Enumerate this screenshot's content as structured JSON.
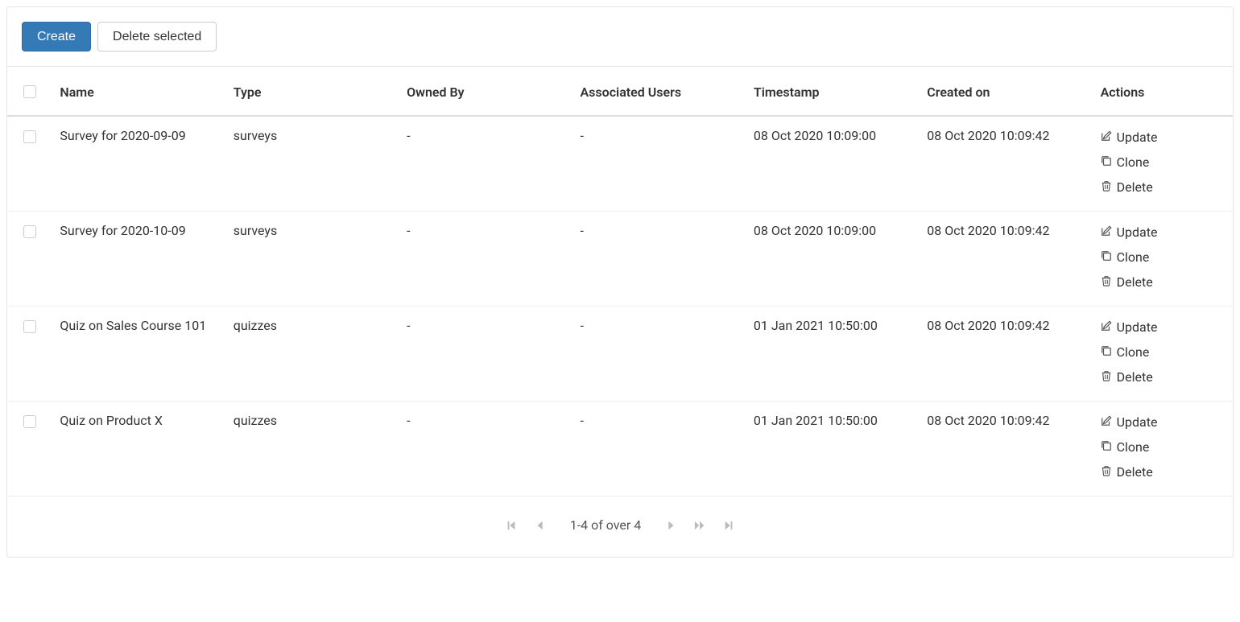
{
  "toolbar": {
    "create_label": "Create",
    "delete_selected_label": "Delete selected"
  },
  "table": {
    "columns": {
      "name": "Name",
      "type": "Type",
      "owned_by": "Owned By",
      "associated_users": "Associated Users",
      "timestamp": "Timestamp",
      "created_on": "Created on",
      "actions": "Actions"
    },
    "rows": [
      {
        "name": "Survey for 2020-09-09",
        "type": "surveys",
        "owned_by": "-",
        "associated_users": "-",
        "timestamp": "08 Oct 2020 10:09:00",
        "created_on": "08 Oct 2020 10:09:42"
      },
      {
        "name": "Survey for 2020-10-09",
        "type": "surveys",
        "owned_by": "-",
        "associated_users": "-",
        "timestamp": "08 Oct 2020 10:09:00",
        "created_on": "08 Oct 2020 10:09:42"
      },
      {
        "name": "Quiz on Sales Course 101",
        "type": "quizzes",
        "owned_by": "-",
        "associated_users": "-",
        "timestamp": "01 Jan 2021 10:50:00",
        "created_on": "08 Oct 2020 10:09:42"
      },
      {
        "name": "Quiz on Product X",
        "type": "quizzes",
        "owned_by": "-",
        "associated_users": "-",
        "timestamp": "01 Jan 2021 10:50:00",
        "created_on": "08 Oct 2020 10:09:42"
      }
    ],
    "action_labels": {
      "update": "Update",
      "clone": "Clone",
      "delete": "Delete"
    }
  },
  "pagination": {
    "info": "1-4 of over 4"
  }
}
